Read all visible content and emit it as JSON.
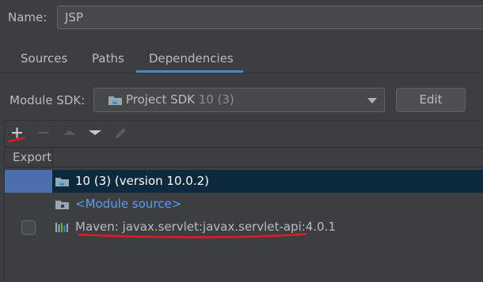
{
  "name_row": {
    "label": "Name:",
    "value": "JSP"
  },
  "tabs": [
    {
      "label": "Sources",
      "active": false
    },
    {
      "label": "Paths",
      "active": false
    },
    {
      "label": "Dependencies",
      "active": true
    }
  ],
  "sdk_row": {
    "label": "Module SDK:",
    "selected_name": "Project SDK",
    "selected_version": "10 (3)",
    "edit_label": "Edit"
  },
  "toolbar": {
    "icons": [
      "add-icon",
      "remove-icon",
      "move-up-icon",
      "move-down-icon",
      "edit-icon"
    ]
  },
  "table": {
    "header_export": "Export",
    "rows": [
      {
        "text": "10 (3) (version 10.0.2)",
        "icon": "sdk-folder-icon",
        "selected": true
      },
      {
        "text": "<Module source>",
        "icon": "source-folder-icon",
        "selected": false
      },
      {
        "text": "Maven: javax.servlet:javax.servlet-api:4.0.1",
        "icon": "library-icon",
        "selected": false,
        "checked": false
      }
    ]
  },
  "colors": {
    "background": "#3c3f41",
    "accent": "#4a88c7",
    "selection": "#4b6eaf",
    "annotation": "#e01b24",
    "link": "#589df6"
  }
}
